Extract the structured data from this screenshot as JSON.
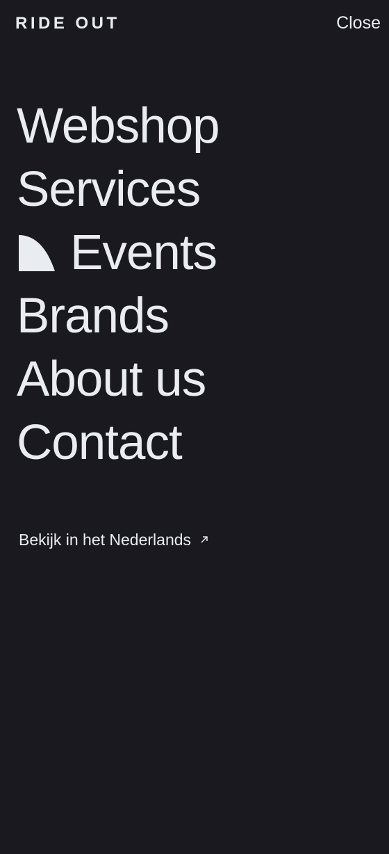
{
  "header": {
    "logo": "RIDE OUT",
    "close_label": "Close"
  },
  "menu": {
    "items": [
      {
        "label": "Webshop",
        "active": false
      },
      {
        "label": "Services",
        "active": false
      },
      {
        "label": "Events",
        "active": true
      },
      {
        "label": "Brands",
        "active": false
      },
      {
        "label": "About us",
        "active": false
      },
      {
        "label": "Contact",
        "active": false
      }
    ]
  },
  "language_link": {
    "label": "Bekijk in het Nederlands",
    "icon": "external-arrow-icon"
  },
  "colors": {
    "background": "#1a191f",
    "foreground": "#e9ecf0"
  }
}
